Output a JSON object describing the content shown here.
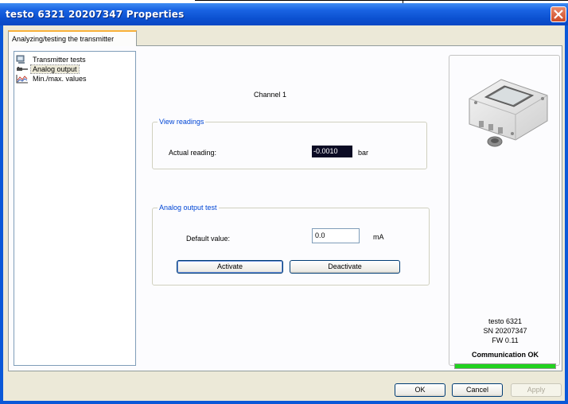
{
  "window": {
    "title": "testo 6321  20207347 Properties"
  },
  "tab": {
    "label": "Analyzing/testing the transmitter"
  },
  "tree": {
    "items": [
      {
        "label": "Transmitter tests",
        "icon": "monitor-icon"
      },
      {
        "label": "Analog output",
        "icon": "cable-plug-icon",
        "selected": true
      },
      {
        "label": "Min./max. values",
        "icon": "chart-line-icon"
      }
    ]
  },
  "channel": {
    "title": "Channel 1"
  },
  "view_readings": {
    "legend": "View readings",
    "actual_reading_label": "Actual reading:",
    "actual_reading_value": "-0.0010",
    "unit": "bar"
  },
  "analog_test": {
    "legend": "Analog output test",
    "default_value_label": "Default value:",
    "default_value": "0.0",
    "unit": "mA",
    "activate_label": "Activate",
    "deactivate_label": "Deactivate"
  },
  "device": {
    "model": "testo 6321",
    "serial": "SN 20207347",
    "firmware": "FW  0.11",
    "communication": "Communication OK",
    "communication_level": 1.0
  },
  "footer": {
    "ok_label": "OK",
    "cancel_label": "Cancel",
    "apply_label": "Apply"
  },
  "colors": {
    "titlebar": "#0a58d8",
    "legend_text": "#0046d5",
    "status_bar": "#21d21f",
    "reading_bg": "#0b0b24"
  }
}
